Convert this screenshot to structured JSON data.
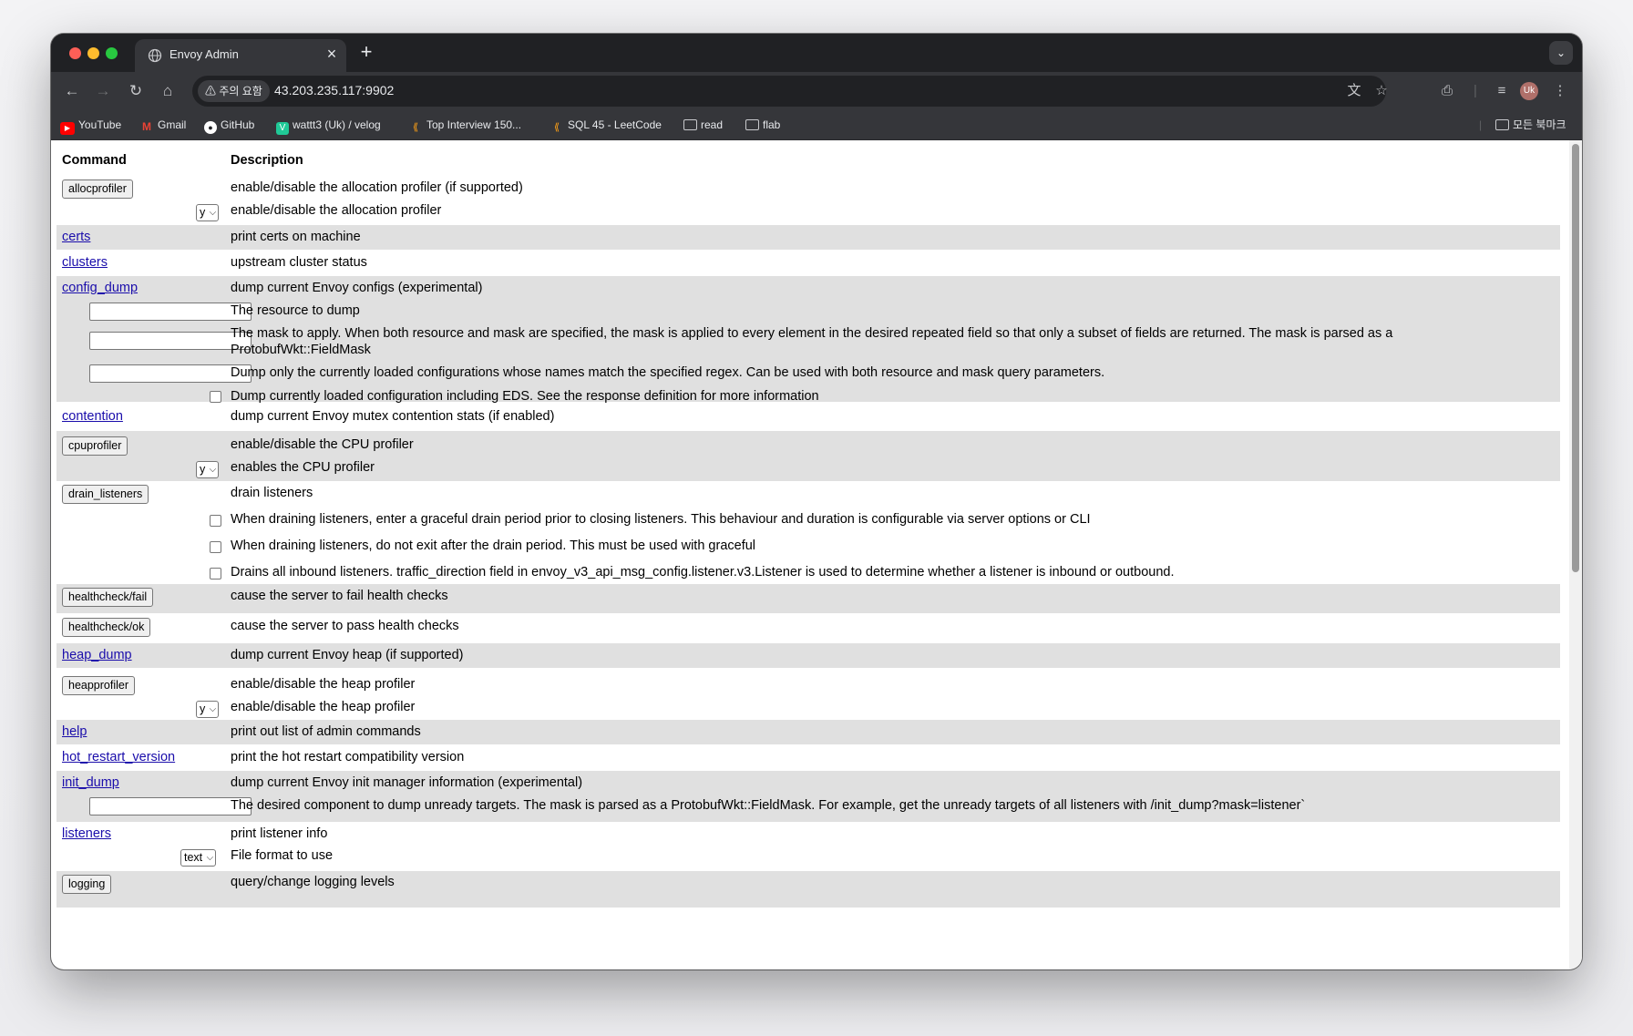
{
  "browser": {
    "tab_title": "Envoy Admin",
    "new_tab_label": "+",
    "close_tab_label": "×",
    "tab_menu_label": "⌄",
    "warning_label": "⚠ 주의 요함",
    "url": "43.203.235.117:9902",
    "avatar_initials": "Uk"
  },
  "bookmarks": {
    "items": [
      {
        "label": "YouTube",
        "icon": "youtube-icon",
        "color": "#ff0000"
      },
      {
        "label": "Gmail",
        "icon": "gmail-icon",
        "color": "#ea4335"
      },
      {
        "label": "GitHub",
        "icon": "github-icon",
        "color": "#ffffff"
      },
      {
        "label": "wattt3 (Uk) / velog",
        "icon": "velog-icon",
        "color": "#20c997"
      },
      {
        "label": "Top Interview 150...",
        "icon": "leetcode-icon",
        "color": "#ffa116"
      },
      {
        "label": "SQL 45 - LeetCode",
        "icon": "leetcode-icon",
        "color": "#ffa116"
      },
      {
        "label": "read",
        "icon": "folder-icon",
        "color": "#e8eaed"
      },
      {
        "label": "flab",
        "icon": "folder-icon",
        "color": "#e8eaed"
      }
    ],
    "all_bookmarks_label": "모든 북마크"
  },
  "table": {
    "header_command": "Command",
    "header_description": "Description",
    "rows": {
      "allocprofiler": {
        "command": "allocprofiler",
        "description": "enable/disable the allocation profiler (if supported)",
        "param_value": "y",
        "param_description": "enable/disable the allocation profiler"
      },
      "certs": {
        "command": "certs",
        "description": "print certs on machine"
      },
      "clusters": {
        "command": "clusters",
        "description": "upstream cluster status"
      },
      "config_dump": {
        "command": "config_dump",
        "description": "dump current Envoy configs (experimental)",
        "param_resource": "The resource to dump",
        "param_mask_line1": "The mask to apply. When both resource and mask are specified, the mask is applied to every element in the desired repeated field so that only a subset of fields are returned. The mask is parsed as a",
        "param_mask_line2": "ProtobufWkt::FieldMask",
        "param_name_regex": "Dump only the currently loaded configurations whose names match the specified regex. Can be used with both resource and mask query parameters.",
        "param_include_eds": "Dump currently loaded configuration including EDS. See the response definition for more information"
      },
      "contention": {
        "command": "contention",
        "description": "dump current Envoy mutex contention stats (if enabled)"
      },
      "cpuprofiler": {
        "command": "cpuprofiler",
        "description": "enable/disable the CPU profiler",
        "param_value": "y",
        "param_description": "enables the CPU profiler"
      },
      "drain_listeners": {
        "command": "drain_listeners",
        "description": "drain listeners",
        "param_graceful": "When draining listeners, enter a graceful drain period prior to closing listeners. This behaviour and duration is configurable via server options or CLI",
        "param_skip_exit": "When draining listeners, do not exit after the drain period. This must be used with graceful",
        "param_inbound_only": "Drains all inbound listeners. traffic_direction field in envoy_v3_api_msg_config.listener.v3.Listener is used to determine whether a listener is inbound or outbound."
      },
      "healthcheck_fail": {
        "command": "healthcheck/fail",
        "description": "cause the server to fail health checks"
      },
      "healthcheck_ok": {
        "command": "healthcheck/ok",
        "description": "cause the server to pass health checks"
      },
      "heap_dump": {
        "command": "heap_dump",
        "description": "dump current Envoy heap (if supported)"
      },
      "heapprofiler": {
        "command": "heapprofiler",
        "description": "enable/disable the heap profiler",
        "param_value": "y",
        "param_description": "enable/disable the heap profiler"
      },
      "help": {
        "command": "help",
        "description": "print out list of admin commands"
      },
      "hot_restart_version": {
        "command": "hot_restart_version",
        "description": "print the hot restart compatibility version"
      },
      "init_dump": {
        "command": "init_dump",
        "description": "dump current Envoy init manager information (experimental)",
        "param_mask": "The desired component to dump unready targets. The mask is parsed as a ProtobufWkt::FieldMask. For example, get the unready targets of all listeners with /init_dump?mask=listener`"
      },
      "listeners": {
        "command": "listeners",
        "description": "print listener info",
        "param_value": "text",
        "param_description": "File format to use"
      },
      "logging": {
        "command": "logging",
        "description": "query/change logging levels"
      }
    }
  }
}
